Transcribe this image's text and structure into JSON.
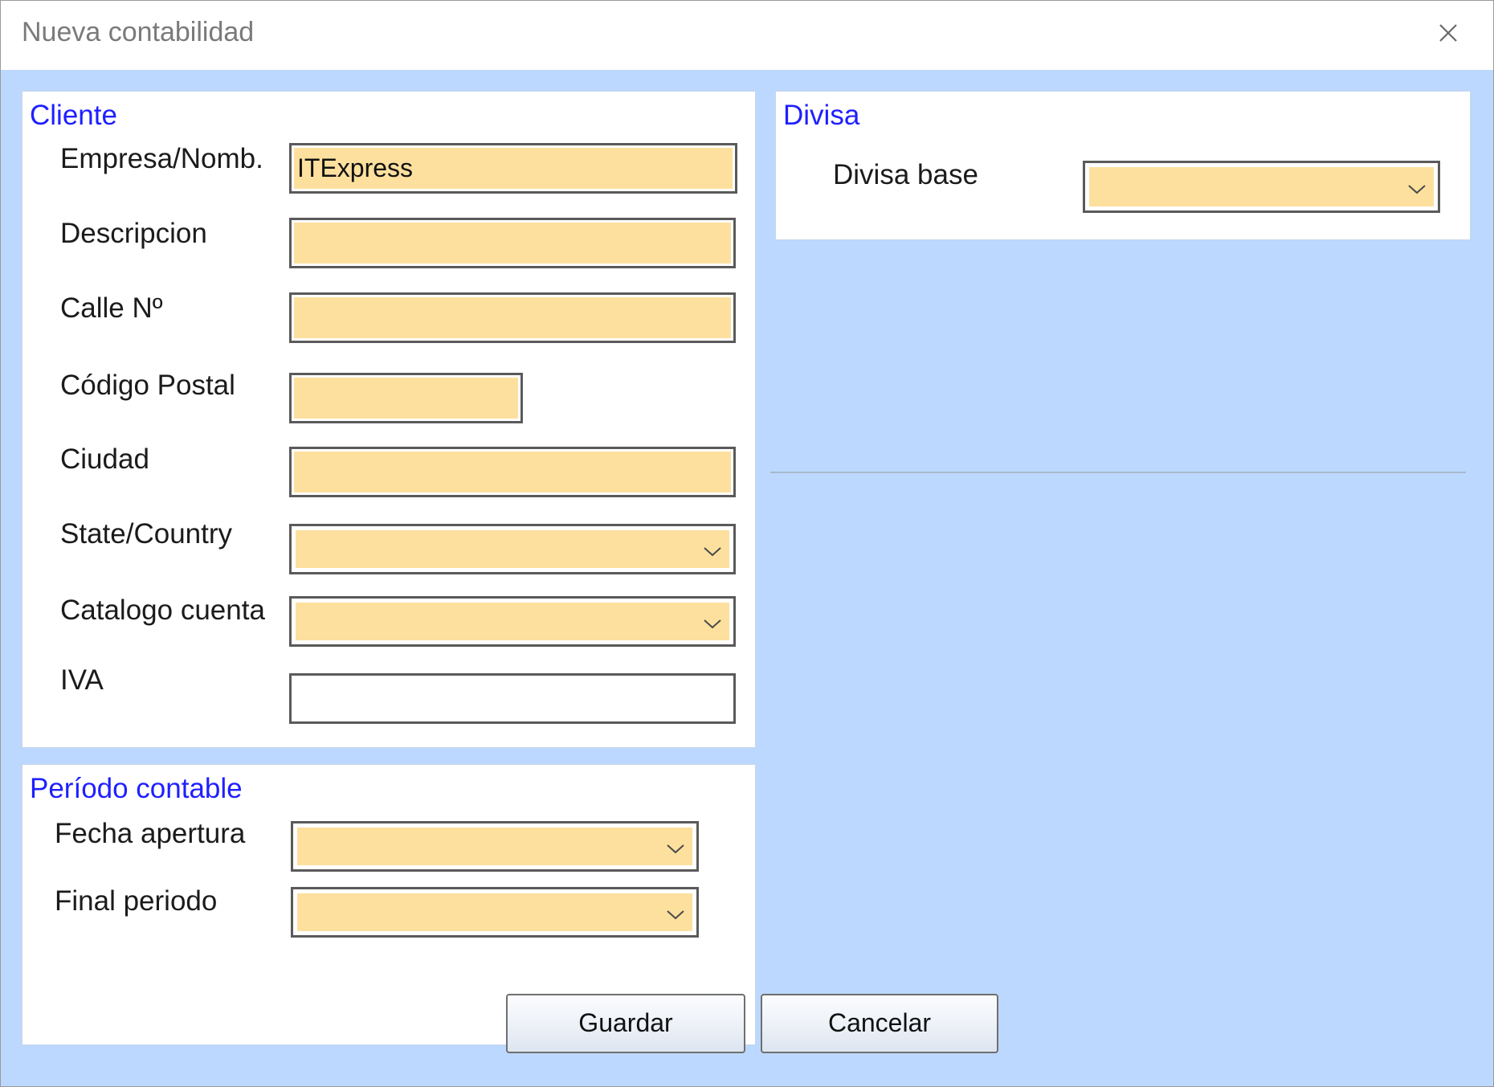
{
  "window": {
    "title": "Nueva contabilidad",
    "close_icon": "close-icon"
  },
  "colors": {
    "background": "#bcd8fe",
    "field_fill": "#fde09e",
    "section_title": "#1f1fff"
  },
  "cliente": {
    "title": "Cliente",
    "empresa_label": "Empresa/Nomb.",
    "empresa_value": "ITExpress",
    "descripcion_label": "Descripcion",
    "descripcion_value": "",
    "calle_label": "Calle Nº",
    "calle_value": "",
    "codigo_postal_label": "Código Postal",
    "codigo_postal_value": "",
    "ciudad_label": "Ciudad",
    "ciudad_value": "",
    "state_label": "State/Country",
    "state_value": "",
    "catalogo_label": "Catalogo cuenta",
    "catalogo_value": "",
    "iva_label": "IVA",
    "iva_value": ""
  },
  "periodo": {
    "title": "Período contable",
    "apertura_label": "Fecha apertura",
    "apertura_value": "",
    "final_label": "Final periodo",
    "final_value": ""
  },
  "divisa": {
    "title": "Divisa",
    "base_label": "Divisa base",
    "base_value": ""
  },
  "buttons": {
    "save": "Guardar",
    "cancel": "Cancelar"
  }
}
